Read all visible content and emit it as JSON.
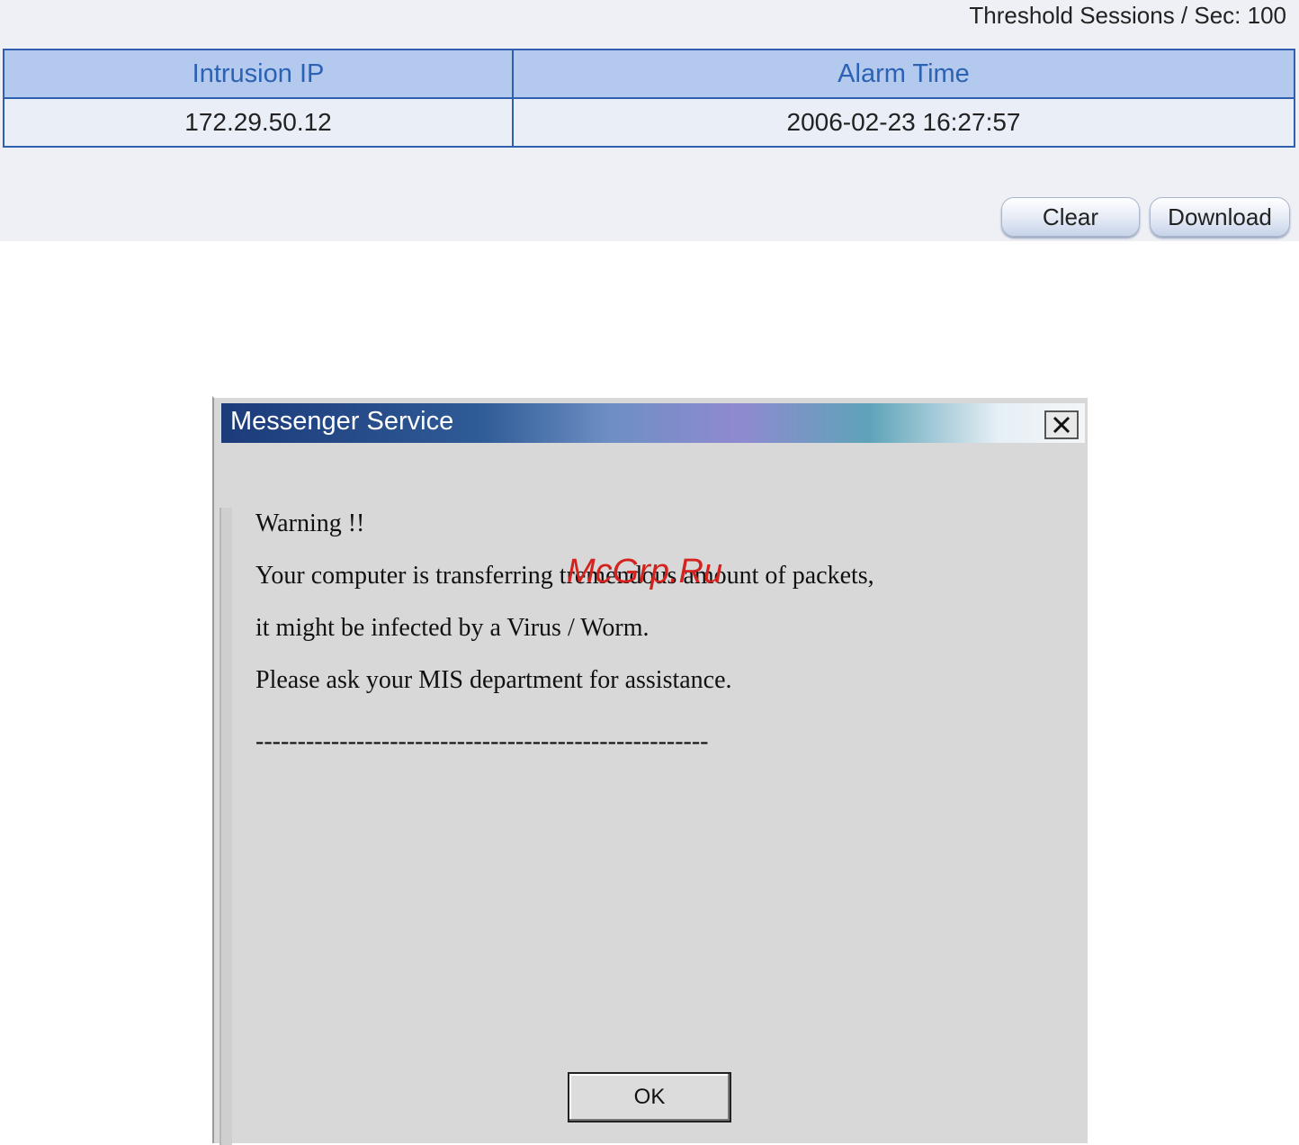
{
  "top_panel": {
    "threshold_text": "Threshold Sessions / Sec: 100",
    "table": {
      "headers": [
        "Intrusion IP",
        "Alarm Time"
      ],
      "rows": [
        [
          "172.29.50.12",
          "2006-02-23 16:27:57"
        ]
      ]
    },
    "buttons": {
      "clear_label": "Clear",
      "download_label": "Download"
    }
  },
  "dialog": {
    "title": "Messenger Service",
    "close_symbol": "×",
    "lines": [
      "Warning !!",
      "Your computer is transferring tremendous amount of packets,",
      "it might be infected by a Virus / Worm.",
      "Please ask your MIS department for assistance."
    ],
    "separator": "------------------------------------------------------",
    "ok_label": "OK"
  },
  "watermark": "McGrp.Ru",
  "colors": {
    "header_bg": "#b4c9ee",
    "header_text": "#2b62b3",
    "table_border": "#2f5fae",
    "watermark": "#d4231f"
  }
}
